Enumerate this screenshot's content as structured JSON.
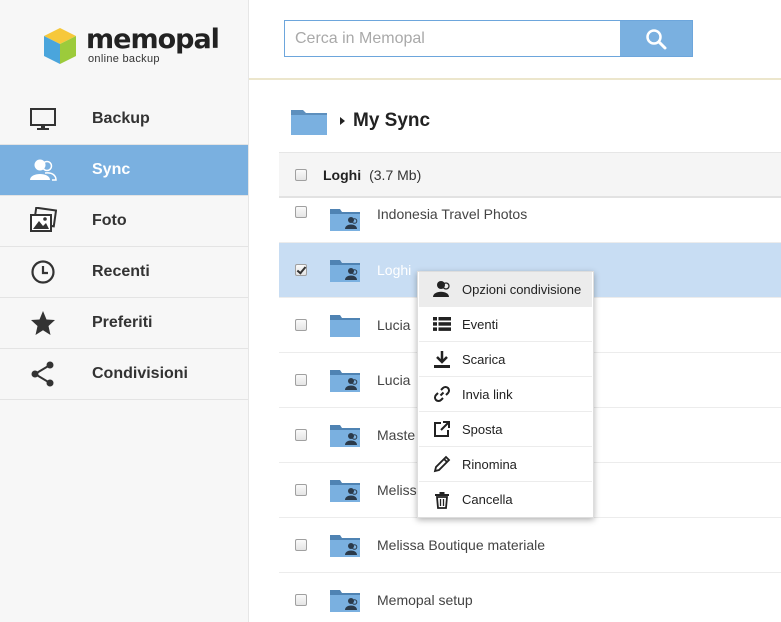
{
  "brand": {
    "name": "memopal",
    "tagline": "online backup"
  },
  "sidebar": {
    "items": [
      {
        "label": "Backup",
        "icon": "monitor-icon",
        "active": false
      },
      {
        "label": "Sync",
        "icon": "user-sync-icon",
        "active": true
      },
      {
        "label": "Foto",
        "icon": "photo-icon",
        "active": false
      },
      {
        "label": "Recenti",
        "icon": "clock-icon",
        "active": false
      },
      {
        "label": "Preferiti",
        "icon": "star-icon",
        "active": false
      },
      {
        "label": "Condivisioni",
        "icon": "share-icon",
        "active": false
      }
    ]
  },
  "search": {
    "placeholder": "Cerca in Memopal",
    "value": ""
  },
  "breadcrumb": {
    "title": "My Sync"
  },
  "list": {
    "header": {
      "name": "Loghi",
      "size": "(3.7 Mb)"
    },
    "rows": [
      {
        "name": "Indonesia Travel Photos",
        "checked": false,
        "shared": true
      },
      {
        "name": "Loghi",
        "checked": true,
        "shared": true
      },
      {
        "name": "Lucia",
        "checked": false,
        "shared": false
      },
      {
        "name": "Lucia",
        "checked": false,
        "shared": true
      },
      {
        "name": "Maste",
        "checked": false,
        "shared": true
      },
      {
        "name": "Meliss",
        "checked": false,
        "shared": true
      },
      {
        "name": "Melissa Boutique materiale",
        "checked": false,
        "shared": true
      },
      {
        "name": "Memopal setup",
        "checked": false,
        "shared": true
      }
    ]
  },
  "context_menu": {
    "items": [
      {
        "label": "Opzioni condivisione",
        "icon": "share-user-icon",
        "highlighted": true
      },
      {
        "label": "Eventi",
        "icon": "list-icon",
        "highlighted": false
      },
      {
        "label": "Scarica",
        "icon": "download-icon",
        "highlighted": false
      },
      {
        "label": "Invia link",
        "icon": "link-icon",
        "highlighted": false
      },
      {
        "label": "Sposta",
        "icon": "move-icon",
        "highlighted": false
      },
      {
        "label": "Rinomina",
        "icon": "pencil-icon",
        "highlighted": false
      },
      {
        "label": "Cancella",
        "icon": "trash-icon",
        "highlighted": false
      }
    ]
  },
  "colors": {
    "accent": "#7ab0e0",
    "selected_row": "#c8ddf3",
    "folder": "#6ea6d8"
  }
}
